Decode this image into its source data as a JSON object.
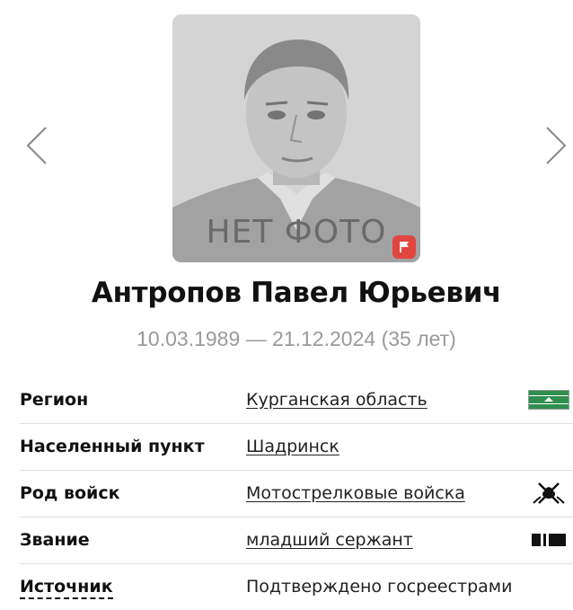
{
  "photo": {
    "placeholder_text": "НЕТ ФОТО"
  },
  "person": {
    "name": "Антропов Павел Юрьевич",
    "birth_date": "10.03.1989",
    "death_date": "21.12.2024",
    "age": "(35 лет)",
    "date_separator": "—"
  },
  "rows": [
    {
      "label": "Регион",
      "value": "Курганская область",
      "icon": "kurgan-region-flag-icon"
    },
    {
      "label": "Населенный пункт",
      "value": "Шадринск"
    },
    {
      "label": "Род войск",
      "value": "Мотострелковые войска",
      "icon": "motor-rifle-troops-emblem-icon"
    },
    {
      "label": "Звание",
      "value": "младший сержант",
      "icon": "junior-sergeant-insignia-icon"
    },
    {
      "label": "Источник",
      "value": "Подтверждено госреестрами"
    }
  ],
  "colors": {
    "report_flag": "#e0453f",
    "muted_text": "#9a9a9a",
    "region_flag_green": "#2f8f4e"
  }
}
